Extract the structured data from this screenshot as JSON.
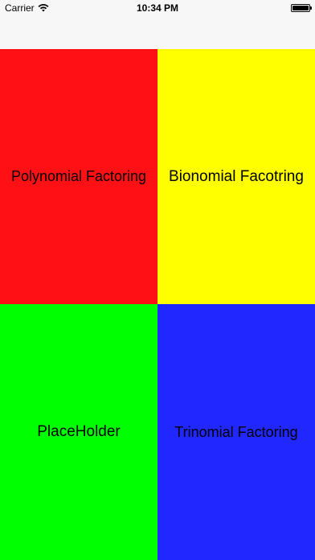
{
  "status_bar": {
    "carrier": "Carrier",
    "time": "10:34 PM"
  },
  "tiles": [
    {
      "label": "Polynomial Factoring",
      "color": "#ff1015"
    },
    {
      "label": "Bionomial Facotring",
      "color": "#ffff00"
    },
    {
      "label": "PlaceHolder",
      "color": "#00ff00"
    },
    {
      "label": "Trinomial Factoring",
      "color": "#2128ff"
    }
  ]
}
